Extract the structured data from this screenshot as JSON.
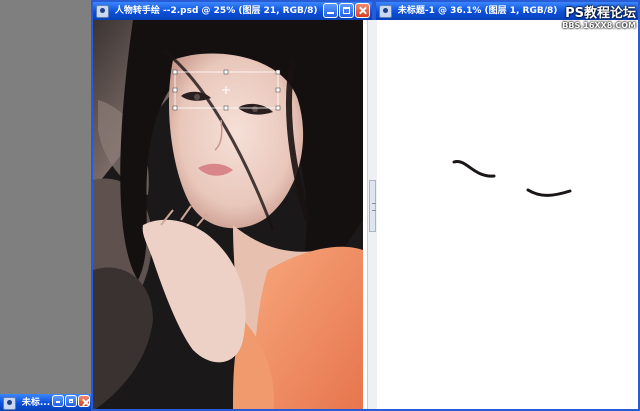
{
  "window_main": {
    "title": "人物转手绘 --2.psd @ 25% (图层 21, RGB/8)",
    "icon": "photoshop-doc-icon"
  },
  "window_right": {
    "title": "未标题-1 @ 36.1% (图层 1, RGB/8)",
    "icon": "photoshop-doc-icon"
  },
  "window_minimized": {
    "title": "未标..."
  },
  "watermark": {
    "line1": "PS教程论坛",
    "line2": "BBS.16XX8.COM"
  },
  "colors": {
    "titlebar": "#0b50d8",
    "workspace": "#7f7f7f",
    "canvas": "#ffffff"
  }
}
